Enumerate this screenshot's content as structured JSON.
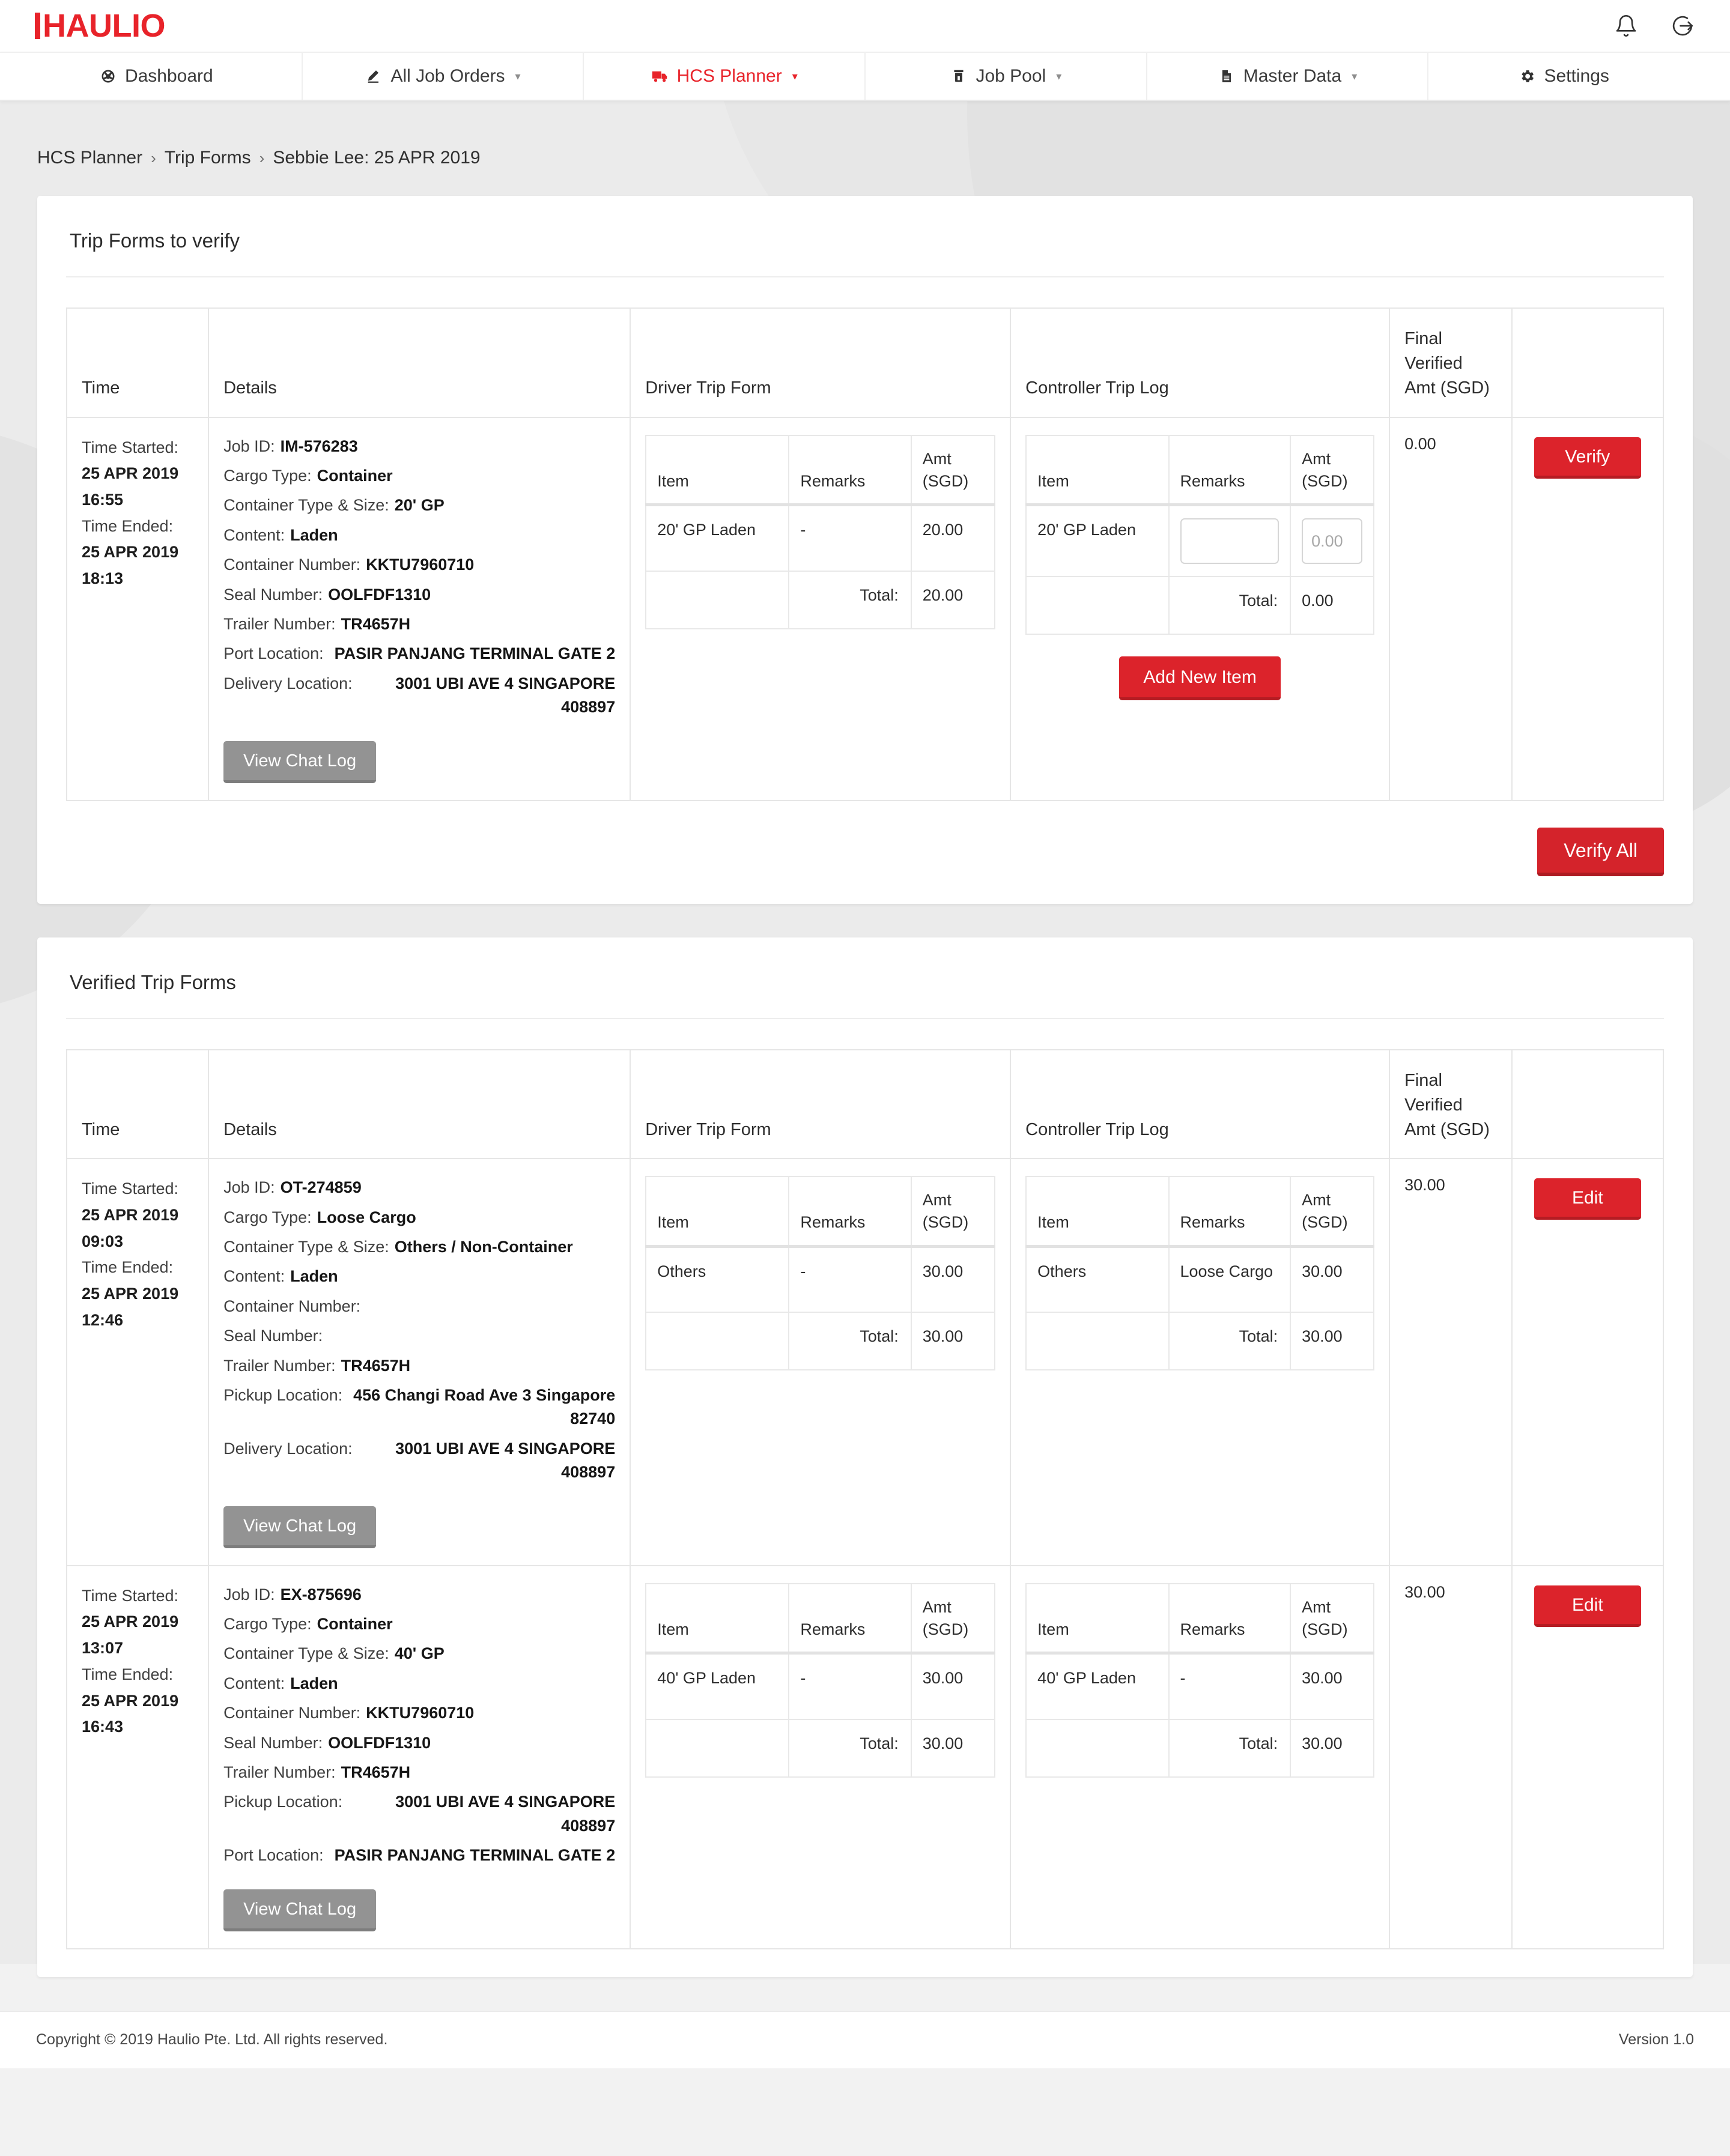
{
  "brand": {
    "logo_text": "HAULIO"
  },
  "topbar": {
    "notifications_icon": "bell-icon",
    "logout_icon": "logout-icon"
  },
  "nav": {
    "items": [
      {
        "label": "Dashboard",
        "icon": "dashboard-icon",
        "caret": "",
        "active": false
      },
      {
        "label": "All Job Orders",
        "icon": "pencil-icon",
        "caret": "▾",
        "active": false
      },
      {
        "label": "HCS Planner",
        "icon": "truck-icon",
        "caret": "▾",
        "active": true
      },
      {
        "label": "Job Pool",
        "icon": "container-icon",
        "caret": "▾",
        "active": false
      },
      {
        "label": "Master Data",
        "icon": "document-icon",
        "caret": "▾",
        "active": false
      },
      {
        "label": "Settings",
        "icon": "gear-icon",
        "caret": "",
        "active": false
      }
    ]
  },
  "breadcrumb": {
    "items": [
      "HCS Planner",
      "Trip Forms",
      "Sebbie Lee: 25 APR 2019"
    ],
    "separator": "›"
  },
  "columns": {
    "time": "Time",
    "details": "Details",
    "driver": "Driver Trip Form",
    "controller": "Controller Trip Log",
    "final": "Final Verified Amt (SGD)",
    "action": ""
  },
  "sub_columns": {
    "item": "Item",
    "remarks": "Remarks",
    "amt": "Amt (SGD)",
    "total": "Total:"
  },
  "labels": {
    "time_started": "Time Started:",
    "time_ended": "Time Ended:",
    "job_id": "Job ID:",
    "cargo_type": "Cargo Type:",
    "container_type_size": "Container Type & Size:",
    "content": "Content:",
    "container_number": "Container Number:",
    "seal_number": "Seal Number:",
    "trailer_number": "Trailer Number:",
    "port_location": "Port Location:",
    "pickup_location": "Pickup Location:",
    "delivery_location": "Delivery Location:",
    "view_chat_log": "View Chat Log",
    "add_new_item": "Add New Item",
    "verify": "Verify",
    "verify_all": "Verify All",
    "edit": "Edit",
    "amount_placeholder": "0.00",
    "remarks_value": ""
  },
  "section_to_verify": {
    "title": "Trip Forms to verify",
    "row": {
      "time_started": "25 APR 2019 16:55",
      "time_ended": "25 APR 2019 18:13",
      "job_id": "IM-576283",
      "cargo_type": "Container",
      "container_type_size": "20' GP",
      "content": "Laden",
      "container_number": "KKTU7960710",
      "seal_number": "OOLFDF1310",
      "trailer_number": "TR4657H",
      "port_location": "PASIR PANJANG TERMINAL GATE 2",
      "delivery_location": "3001 UBI AVE 4 SINGAPORE 408897",
      "driver_form": {
        "item": "20' GP Laden",
        "remarks": "-",
        "amt": "20.00",
        "total": "20.00"
      },
      "controller_log": {
        "item": "20' GP Laden",
        "remarks_value": "",
        "amt_placeholder": "0.00",
        "total": "0.00"
      },
      "final_amt": "0.00",
      "action": "Verify"
    }
  },
  "section_verified": {
    "title": "Verified Trip Forms",
    "rows": [
      {
        "time_started": "25 APR 2019 09:03",
        "time_ended": "25 APR 2019 12:46",
        "job_id": "OT-274859",
        "cargo_type": "Loose Cargo",
        "container_type_size": "Others / Non-Container",
        "content": "Laden",
        "container_number": "",
        "seal_number": "",
        "trailer_number": "TR4657H",
        "pickup_location": "456 Changi Road Ave 3 Singapore 82740",
        "delivery_location": "3001 UBI AVE 4 SINGAPORE 408897",
        "driver_form": {
          "item": "Others",
          "remarks": "-",
          "amt": "30.00",
          "total": "30.00"
        },
        "controller_log": {
          "item": "Others",
          "remarks": "Loose Cargo",
          "amt": "30.00",
          "total": "30.00"
        },
        "final_amt": "30.00",
        "action": "Edit"
      },
      {
        "time_started": "25 APR 2019 13:07",
        "time_ended": "25 APR 2019 16:43",
        "job_id": "EX-875696",
        "cargo_type": "Container",
        "container_type_size": "40' GP",
        "content": "Laden",
        "container_number": "KKTU7960710",
        "seal_number": "OOLFDF1310",
        "trailer_number": "TR4657H",
        "pickup_location": "3001 UBI AVE 4 SINGAPORE 408897",
        "port_location": "PASIR PANJANG TERMINAL GATE 2",
        "driver_form": {
          "item": "40' GP Laden",
          "remarks": "-",
          "amt": "30.00",
          "total": "30.00"
        },
        "controller_log": {
          "item": "40' GP Laden",
          "remarks": "-",
          "amt": "30.00",
          "total": "30.00"
        },
        "final_amt": "30.00",
        "action": "Edit"
      }
    ]
  },
  "footer": {
    "copyright": "Copyright © 2019 Haulio Pte. Ltd. All rights reserved.",
    "version": "Version 1.0"
  },
  "colors": {
    "brand_red": "#e8232a",
    "button_red": "#dc232b",
    "grey_button": "#939393"
  }
}
